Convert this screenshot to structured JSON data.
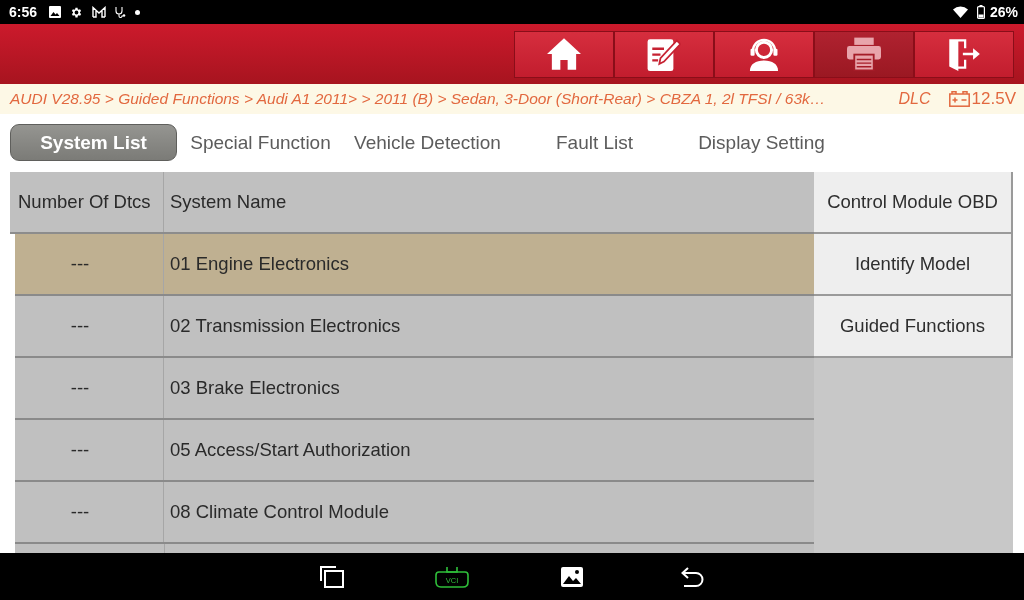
{
  "status_bar": {
    "time": "6:56",
    "battery": "26%"
  },
  "toolbar": {
    "buttons": [
      {
        "kind": "home",
        "disabled": false
      },
      {
        "kind": "report",
        "disabled": false
      },
      {
        "kind": "support",
        "disabled": false
      },
      {
        "kind": "print",
        "disabled": true
      },
      {
        "kind": "exit",
        "disabled": false
      }
    ]
  },
  "breadcrumb": {
    "path": "AUDI V28.95 > Guided Functions > Audi A1 2011> > 2011 (B) > Sedan, 3-Door (Short-Rear) > CBZA 1, 2l TFSI / 63k…",
    "connector": "DLC",
    "voltage": "12.5V"
  },
  "tabs": [
    {
      "label": "System List",
      "selected": true
    },
    {
      "label": "Special Function",
      "selected": false
    },
    {
      "label": "Vehicle Detection",
      "selected": false
    },
    {
      "label": "Fault List",
      "selected": false
    },
    {
      "label": "Display Setting",
      "selected": false
    }
  ],
  "table": {
    "columns": [
      "Number Of Dtcs",
      "System Name"
    ],
    "rows": [
      {
        "dtcs": "---",
        "system": "01 Engine Electronics",
        "selected": true
      },
      {
        "dtcs": "---",
        "system": "02 Transmission Electronics",
        "selected": false
      },
      {
        "dtcs": "---",
        "system": "03 Brake Electronics",
        "selected": false
      },
      {
        "dtcs": "---",
        "system": "05 Access/Start Authorization",
        "selected": false
      },
      {
        "dtcs": "---",
        "system": "08 Climate Control Module",
        "selected": false
      }
    ]
  },
  "side_buttons": [
    {
      "label": "Control Module OBD"
    },
    {
      "label": "Identify Model"
    },
    {
      "label": "Guided Functions"
    }
  ],
  "nav_bar": {
    "vci_label": "VCI"
  }
}
